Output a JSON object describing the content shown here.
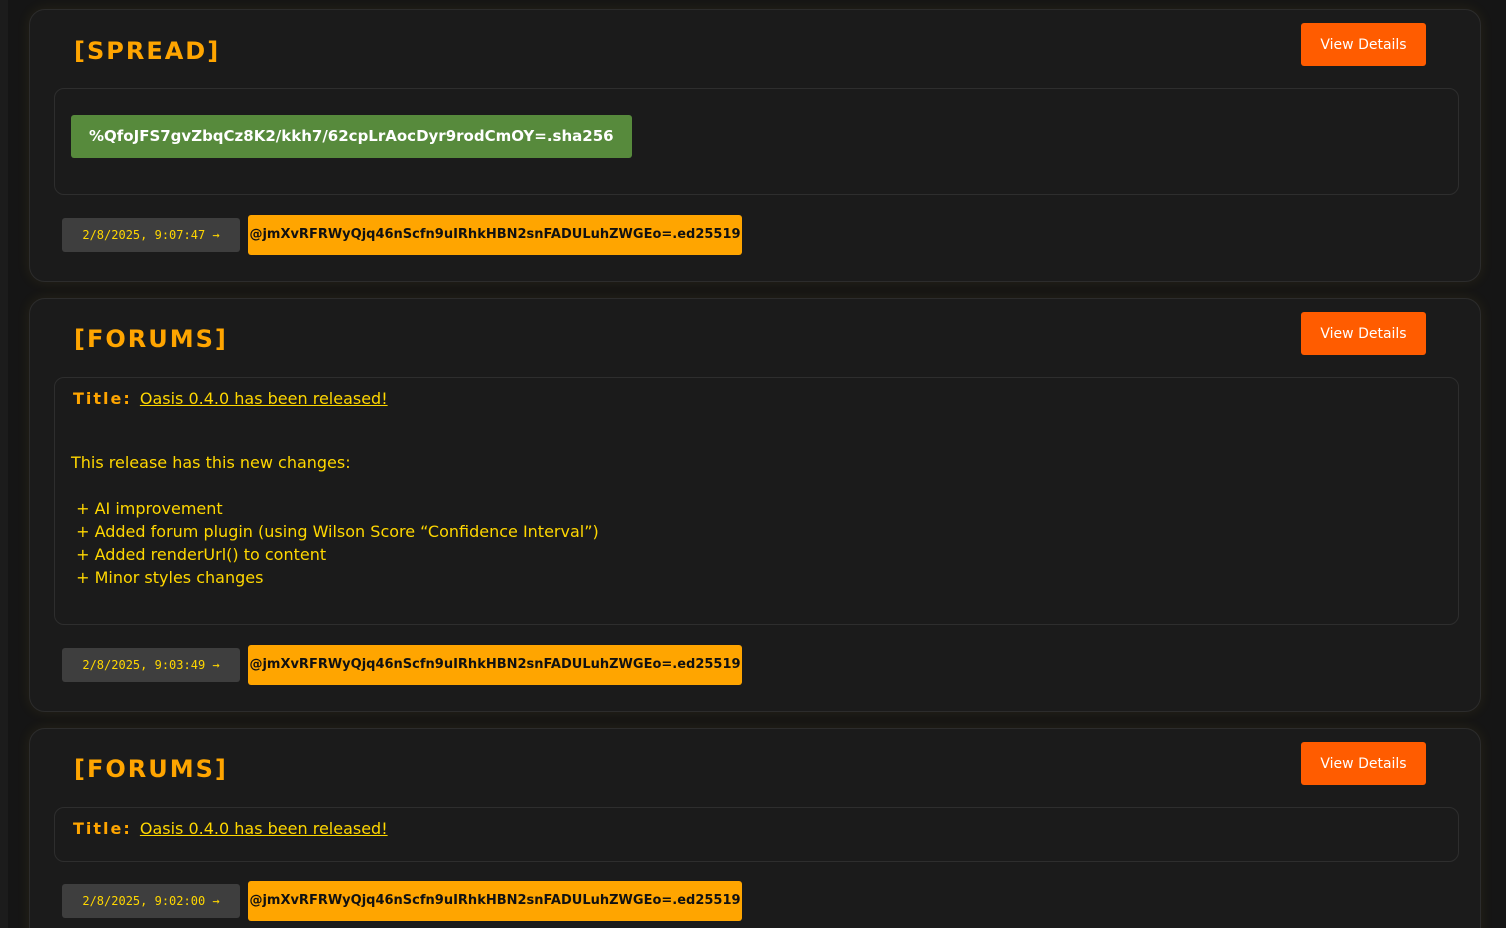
{
  "colors": {
    "background": "#151515",
    "card": "#1b1b1b",
    "accent_orange": "#ffa500",
    "button_orange": "#ff5c00",
    "text_yellow": "#ffd700",
    "hash_green": "#578a3c",
    "timestamp_bg": "#3e3e3e"
  },
  "view_details_label": "View Details",
  "posts": [
    {
      "type_label": "[SPREAD]",
      "hash": "%QfoJFS7gvZbqCz8K2/kkh7/62cpLrAocDyr9rodCmOY=.sha256",
      "timestamp": "2/8/2025, 9:07:47 →",
      "author": "@jmXvRFRWyQjq46nScfn9uIRhkHBN2snFADULuhZWGEo=.ed25519"
    },
    {
      "type_label": "[FORUMS]",
      "title_label": "Title:",
      "title": "Oasis 0.4.0 has been released!",
      "body": "This release has this new changes:\n\n + AI improvement\n + Added forum plugin (using Wilson Score “Confidence Interval”)\n + Added renderUrl() to content\n + Minor styles changes",
      "timestamp": "2/8/2025, 9:03:49 →",
      "author": "@jmXvRFRWyQjq46nScfn9uIRhkHBN2snFADULuhZWGEo=.ed25519"
    },
    {
      "type_label": "[FORUMS]",
      "title_label": "Title:",
      "title": "Oasis 0.4.0 has been released!",
      "timestamp": "2/8/2025, 9:02:00 →",
      "author": "@jmXvRFRWyQjq46nScfn9uIRhkHBN2snFADULuhZWGEo=.ed25519"
    }
  ]
}
